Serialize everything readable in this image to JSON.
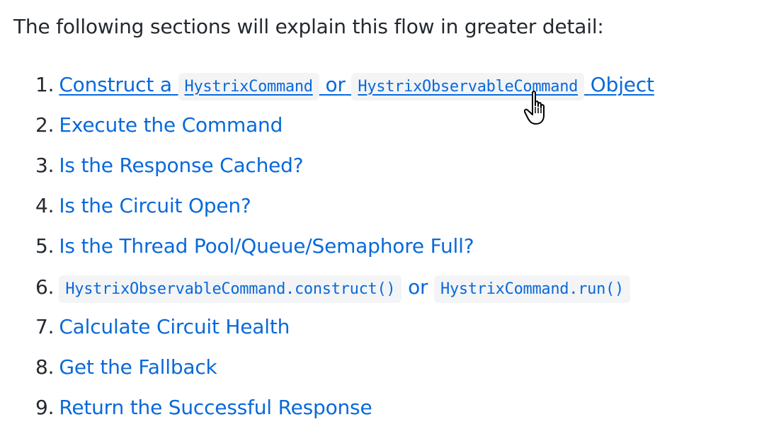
{
  "intro": "The following sections will explain this flow in greater detail:",
  "steps": [
    {
      "number": "1.",
      "construct_prefix": "Construct a",
      "code1": "HystrixCommand",
      "or": "or",
      "code2": "HystrixObservableCommand",
      "suffix": "Object"
    },
    {
      "number": "2.",
      "label": "Execute the Command"
    },
    {
      "number": "3.",
      "label": "Is the Response Cached?"
    },
    {
      "number": "4.",
      "label": "Is the Circuit Open?"
    },
    {
      "number": "5.",
      "label": "Is the Thread Pool/Queue/Semaphore Full?"
    },
    {
      "number": "6.",
      "code1": "HystrixObservableCommand.construct()",
      "or": "or",
      "code2": "HystrixCommand.run()"
    },
    {
      "number": "7.",
      "label": "Calculate Circuit Health"
    },
    {
      "number": "8.",
      "label": "Get the Fallback"
    },
    {
      "number": "9.",
      "label": "Return the Successful Response"
    }
  ],
  "colors": {
    "link": "#0969da",
    "text": "#24292f",
    "code_bg": "#f3f4f6"
  },
  "cursor_icon": "hand-pointer-icon"
}
